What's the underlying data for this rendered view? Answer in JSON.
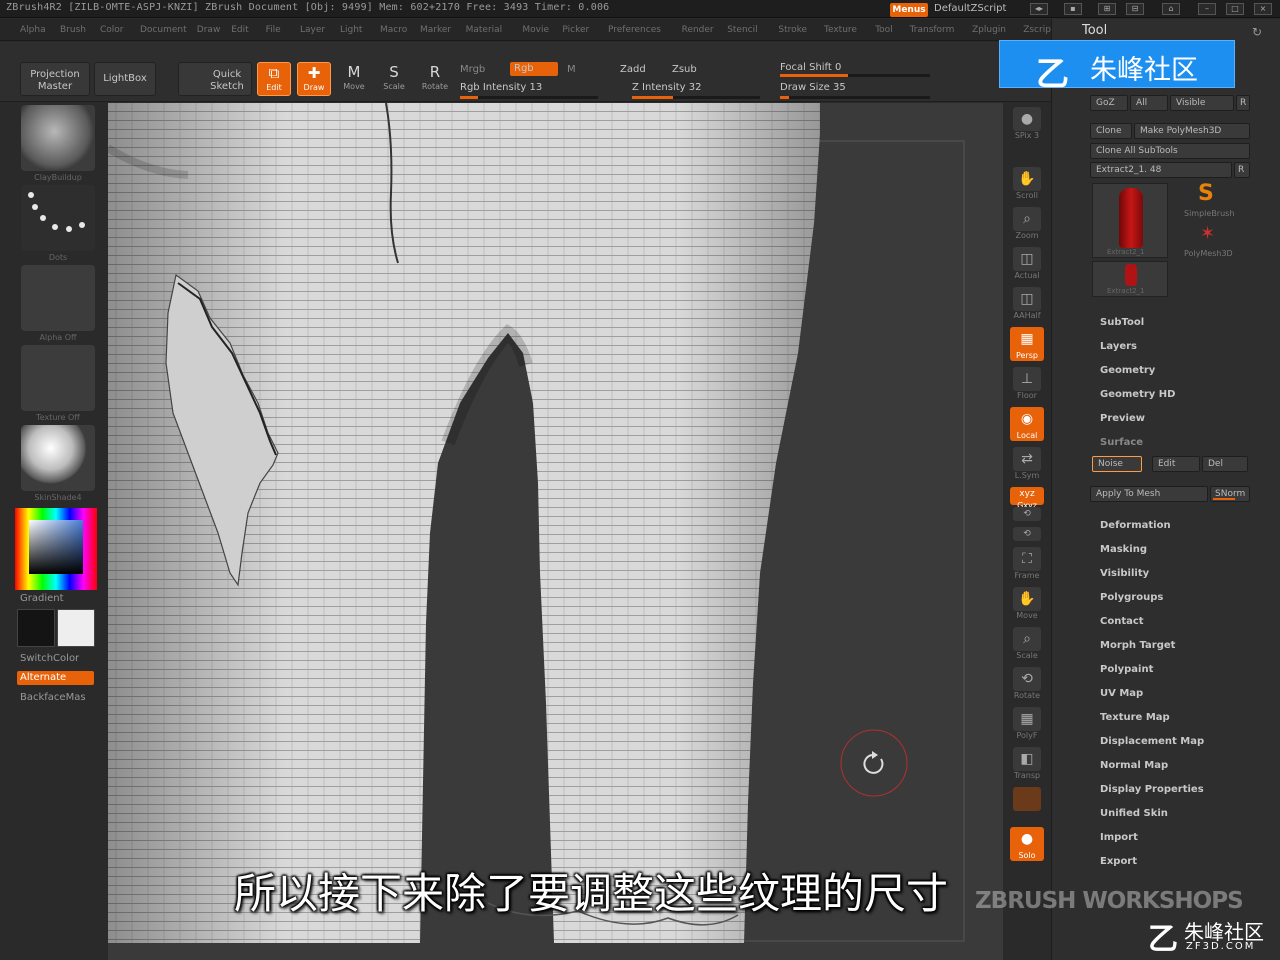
{
  "app": {
    "title": "ZBrush4R2 [ZILB-OMTE-ASPJ-KNZI]   ZBrush Document   [Obj: 9499] Mem: 602+2170 Free: 3493 Timer: 0.006",
    "menus_label": "Menus",
    "script_label": "DefaultZScript"
  },
  "menubar": [
    "Alpha",
    "Brush",
    "Color",
    "Document",
    "Draw",
    "Edit",
    "File",
    "Layer",
    "Light",
    "Macro",
    "Marker",
    "Material",
    "Movie",
    "Picker",
    "Preferences",
    "Render",
    "Stencil",
    "Stroke",
    "Texture",
    "Tool",
    "Transform",
    "Zplugin",
    "Zscript"
  ],
  "shelf": {
    "projection_master": "Projection Master",
    "lightbox": "LightBox",
    "quick_sketch": "Quick Sketch",
    "edit": "Edit",
    "draw": "Draw",
    "move": "Move",
    "scale": "Scale",
    "rotate": "Rotate",
    "mrgb": "Mrgb",
    "rgb": "Rgb",
    "m": "M",
    "rgb_intensity": "Rgb Intensity 13",
    "zadd": "Zadd",
    "zsub": "Zsub",
    "z_intensity": "Z Intensity 32",
    "focal_shift": "Focal Shift 0",
    "draw_size": "Draw Size 35",
    "rgb_intensity_level": 0.13,
    "z_intensity_level": 0.32,
    "focal_shift_level": 0.0,
    "draw_size_level": 0.05
  },
  "lefttray": {
    "captions": [
      "ClayBuildup",
      "Dots",
      "Alpha Off",
      "Texture Off",
      "SkinShade4"
    ],
    "gradient": "Gradient",
    "switchcolor": "SwitchColor",
    "alternate": "Alternate",
    "backface": "BackfaceMas"
  },
  "righttray": [
    "SPix 3",
    "Scroll",
    "Zoom",
    "Actual",
    "AAHalf",
    "Persp",
    "Floor",
    "Local",
    "L.Sym",
    "Gxyz",
    "",
    "",
    "Frame",
    "Move",
    "Scale",
    "Rotate",
    "PolyF",
    "Transp",
    "",
    "Solo"
  ],
  "toolpanel": {
    "title": "Tool",
    "goz": "GoZ",
    "all": "All",
    "visible": "Visible",
    "r": "R",
    "clone": "Clone",
    "make_polymesh": "Make PolyMesh3D",
    "clone_all": "Clone All SubTools",
    "extract": "Extract2_1. 48",
    "extract_r": "R",
    "thumb1_cap": "Extract2_1",
    "thumb2_cap": "Extract2_1",
    "simplebrush": "SimpleBrush",
    "polymesh": "PolyMesh3D",
    "sections": [
      "SubTool",
      "Layers",
      "Geometry",
      "Geometry HD",
      "Preview",
      "Surface",
      "Deformation",
      "Masking",
      "Visibility",
      "Polygroups",
      "Contact",
      "Morph Target",
      "Polypaint",
      "UV Map",
      "Texture Map",
      "Displacement Map",
      "Normal Map",
      "Display Properties",
      "Unified Skin",
      "Import",
      "Export"
    ],
    "noise": "Noise",
    "edit": "Edit",
    "del": "Del",
    "apply_to_mesh": "Apply To Mesh",
    "snorm": "SNorm"
  },
  "subtitle": "所以接下来除了要调整这些纹理的尺寸",
  "watermark": "ZBRUSH WORKSHOPS",
  "banner": {
    "glyph": "乙",
    "text": "朱峰社区"
  },
  "logo2": {
    "text": "朱峰社区",
    "url": "ZF3D.COM"
  },
  "colors": {
    "accent": "#e8620a",
    "banner": "#1d8ff0",
    "viewport": "#3a3a3a",
    "clay": "#d9d9d9"
  }
}
